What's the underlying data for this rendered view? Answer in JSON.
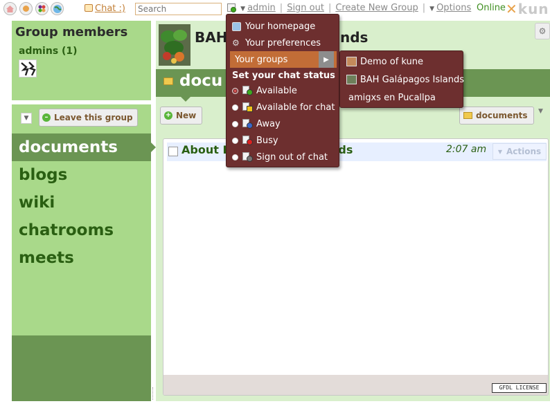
{
  "topbar": {
    "chat_label": "Chat :)",
    "search_placeholder": "Search",
    "user_name": "admin",
    "signout_label": "Sign out",
    "create_group_label": "Create New Group",
    "options_label": "Options",
    "online_label": "Online",
    "logo_text": "kun"
  },
  "sidebar": {
    "members_title": "Group members",
    "admins_label": "admins (1)",
    "leave_group_label": "Leave this group",
    "nav": [
      {
        "label": "documents",
        "active": true
      },
      {
        "label": "blogs",
        "active": false
      },
      {
        "label": "wiki",
        "active": false
      },
      {
        "label": "chatrooms",
        "active": false
      },
      {
        "label": "meets",
        "active": false
      }
    ]
  },
  "main": {
    "group_title": "BAH",
    "group_title_tail": "nds",
    "tool_title": "docu",
    "new_label": "New",
    "documents_button_label": "documents",
    "doc_row": {
      "title_head": "About B",
      "title_tail": "nds",
      "time": "2:07 am",
      "actions_label": "Actions"
    },
    "license_label": "GFDL LICENSE"
  },
  "user_menu": {
    "items": [
      {
        "label": "Your homepage",
        "icon": "home-icon"
      },
      {
        "label": "Your preferences",
        "icon": "gear-icon"
      },
      {
        "label": "Your groups",
        "icon": "submenu-arrow-icon",
        "highlight": true
      }
    ],
    "chat_status_header": "Set your chat status",
    "statuses": [
      {
        "label": "Available",
        "color": "#3faa1f",
        "selected": true
      },
      {
        "label": "Available for chat",
        "color": "#f2c21b",
        "selected": false
      },
      {
        "label": "Away",
        "color": "#3b67c9",
        "selected": false
      },
      {
        "label": "Busy",
        "color": "#d92121",
        "selected": false
      },
      {
        "label": "Sign out of chat",
        "color": "#777777",
        "selected": false
      }
    ]
  },
  "groups_submenu": {
    "items": [
      {
        "label": "Demo of kune",
        "thumb_color": "#c48a5b"
      },
      {
        "label": "BAH Galápagos Islands",
        "thumb_color": "#6d7f5a"
      },
      {
        "label": "amigxs en Pucallpa",
        "thumb_color": ""
      }
    ]
  },
  "colors": {
    "sidebar_green": "#a9d98a",
    "dark_green": "#6b9553",
    "menu_brown": "#6d2f2f",
    "menu_highlight": "#c26d37"
  }
}
